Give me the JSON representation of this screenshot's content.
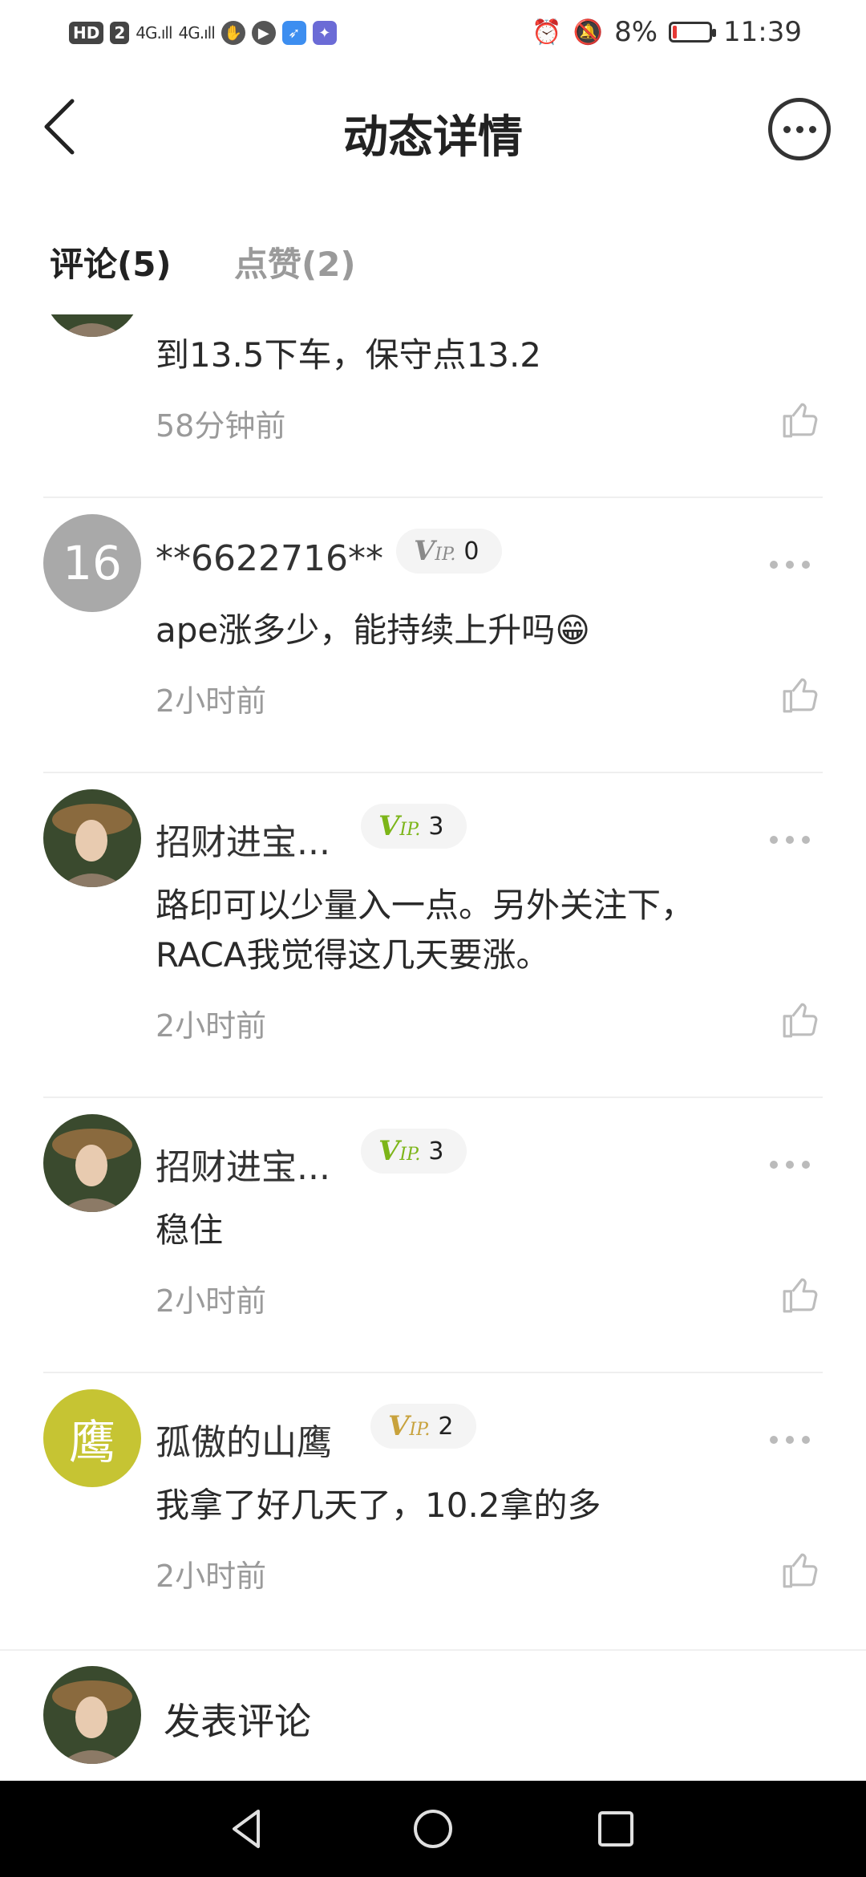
{
  "status_bar": {
    "hd_badge": "HD",
    "sim_badge": "2",
    "signal_1": "4G.ıll",
    "signal_2": "4G.ıll",
    "battery_percent": "8%",
    "time": "11:39"
  },
  "header": {
    "title": "动态详情"
  },
  "tabs": [
    {
      "label": "评论(5)",
      "active": true
    },
    {
      "label": "点赞(2)",
      "active": false
    }
  ],
  "comments": [
    {
      "text": "到13.5下车，保守点13.2",
      "time": "58分钟前"
    },
    {
      "avatar_text": "16",
      "avatar_color": "#a9a9a9",
      "username": "**6622716**",
      "vip_level": "0",
      "vip_color": "#8a8a8a",
      "text": "ape涨多少，能持续上升吗😁",
      "time": "2小时前"
    },
    {
      "username": "招财进宝...",
      "vip_level": "3",
      "vip_color": "#7cb518",
      "text": "路印可以少量入一点。另外关注下，RACA我觉得这几天要涨。",
      "time": "2小时前"
    },
    {
      "username": "招财进宝...",
      "vip_level": "3",
      "vip_color": "#7cb518",
      "text": "稳住",
      "time": "2小时前"
    },
    {
      "avatar_text": "鹰",
      "avatar_color": "#c6c433",
      "username": "孤傲的山鹰",
      "vip_level": "2",
      "vip_color": "#c8a23c",
      "text": "我拿了好几天了，10.2拿的多",
      "time": "2小时前"
    }
  ],
  "vip_text": {
    "v": "V",
    "ip": "IP."
  },
  "bottom_bar": {
    "post_label": "发表评论"
  }
}
